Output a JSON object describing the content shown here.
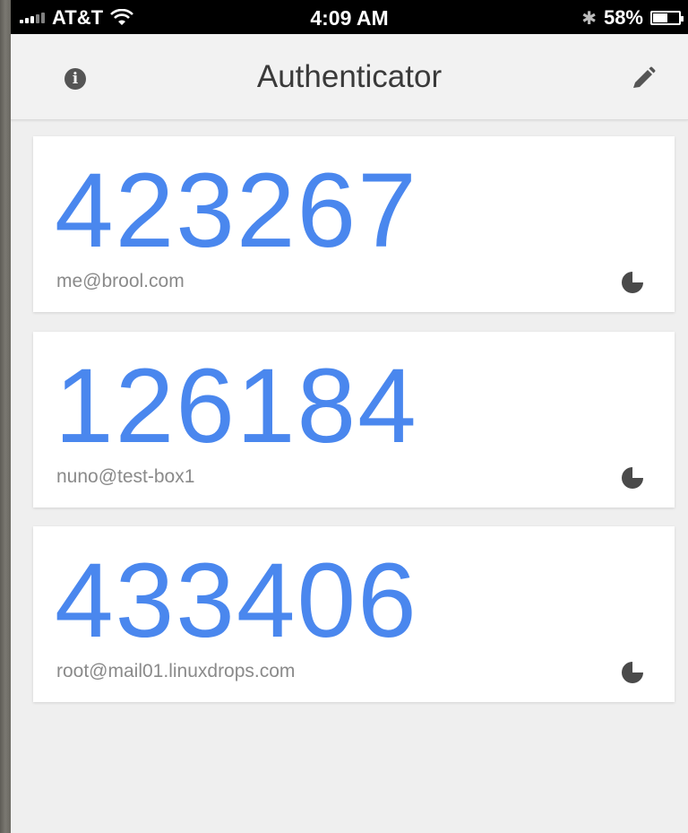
{
  "status_bar": {
    "carrier": "AT&T",
    "time": "4:09 AM",
    "battery_percent": "58%",
    "battery_level": 0.58
  },
  "app_bar": {
    "title": "Authenticator",
    "left_icon": "info-icon",
    "right_icon": "pencil-edit-icon"
  },
  "accounts": [
    {
      "code": "423267",
      "account": "me@brool.com",
      "timer_remaining": 0.75
    },
    {
      "code": "126184",
      "account": "nuno@test-box1",
      "timer_remaining": 0.75
    },
    {
      "code": "433406",
      "account": "root@mail01.linuxdrops.com",
      "timer_remaining": 0.75
    }
  ],
  "colors": {
    "code_blue": "#4a87ee",
    "account_gray": "#8a8a8a",
    "timer_gray": "#4a4a4a",
    "background": "#efefef"
  }
}
